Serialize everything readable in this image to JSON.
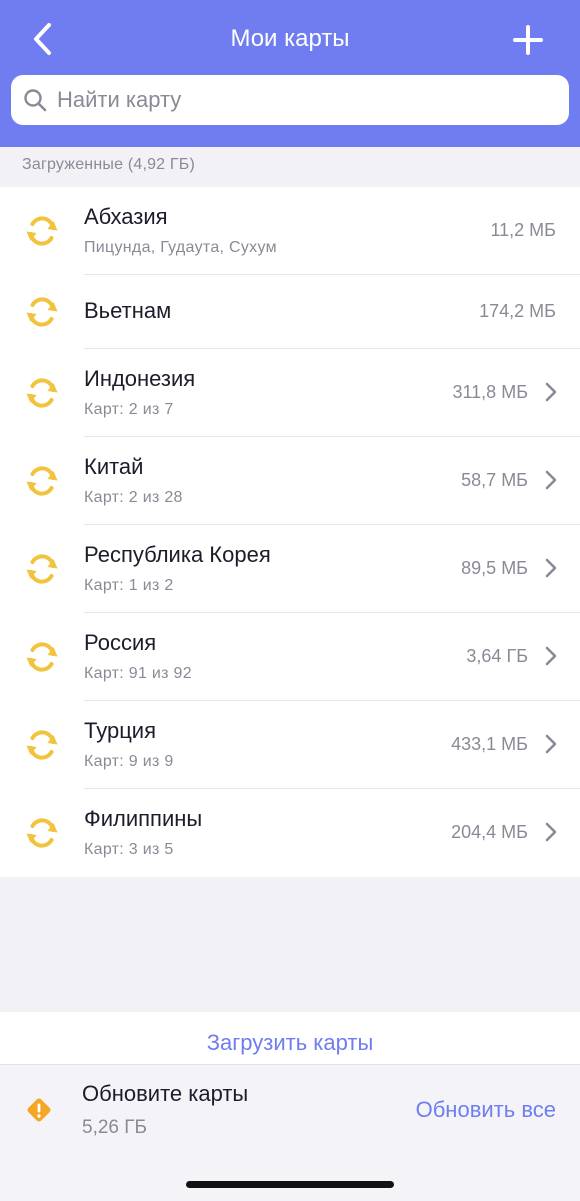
{
  "header": {
    "title": "Мои карты",
    "background": "#6f7df0"
  },
  "search": {
    "placeholder": "Найти карту"
  },
  "section": {
    "title": "Загруженные (4,92 ГБ)"
  },
  "items": [
    {
      "name": "Абхазия",
      "subtitle": "Пицунда, Гудаута, Сухум",
      "size": "11,2 МБ",
      "chevron": false,
      "icon": "sync-icon"
    },
    {
      "name": "Вьетнам",
      "subtitle": "",
      "size": "174,2 МБ",
      "chevron": false,
      "icon": "sync-icon"
    },
    {
      "name": "Индонезия",
      "subtitle": "Карт: 2 из 7",
      "size": "311,8 МБ",
      "chevron": true,
      "icon": "sync-icon"
    },
    {
      "name": "Китай",
      "subtitle": "Карт: 2 из 28",
      "size": "58,7 МБ",
      "chevron": true,
      "icon": "sync-icon"
    },
    {
      "name": "Республика Корея",
      "subtitle": "Карт: 1 из 2",
      "size": "89,5 МБ",
      "chevron": true,
      "icon": "sync-icon"
    },
    {
      "name": "Россия",
      "subtitle": "Карт: 91 из 92",
      "size": "3,64 ГБ",
      "chevron": true,
      "icon": "sync-icon"
    },
    {
      "name": "Турция",
      "subtitle": "Карт: 9 из 9",
      "size": "433,1 МБ",
      "chevron": true,
      "icon": "sync-icon"
    },
    {
      "name": "Филиппины",
      "subtitle": "Карт: 3 из 5",
      "size": "204,4 МБ",
      "chevron": true,
      "icon": "sync-icon"
    }
  ],
  "load": {
    "label": "Загрузить карты"
  },
  "update": {
    "title": "Обновите карты",
    "size": "5,26 ГБ",
    "action": "Обновить все"
  },
  "colors": {
    "accent": "#6f7df0",
    "sync_icon": "#f2c43d",
    "warning": "#f5a623"
  }
}
